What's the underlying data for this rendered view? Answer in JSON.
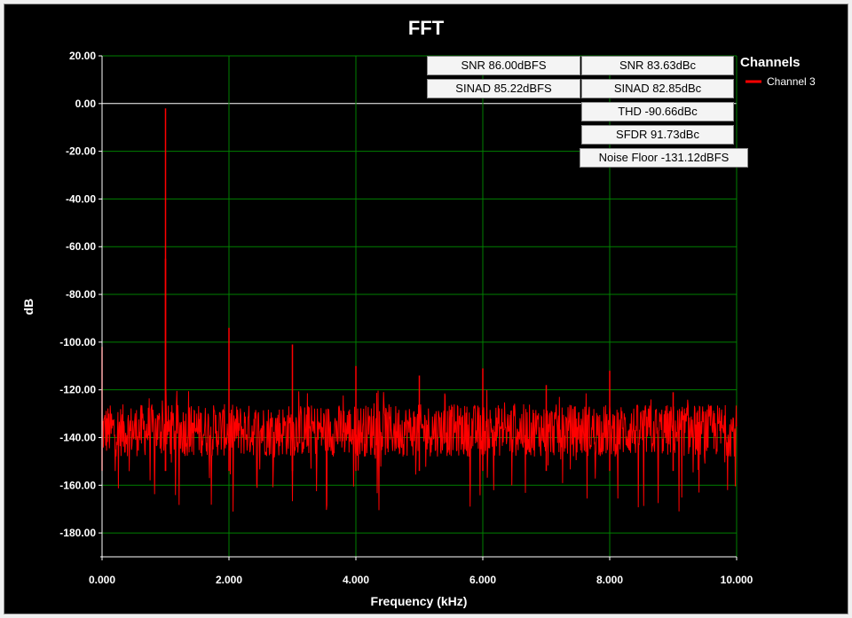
{
  "chart_data": {
    "type": "line",
    "title": "FFT",
    "xlabel": "Frequency (kHz)",
    "ylabel": "dB",
    "xlim": [
      0,
      10
    ],
    "ylim": [
      -190,
      20
    ],
    "x_ticks": [
      "0.000",
      "2.000",
      "4.000",
      "6.000",
      "8.000",
      "10.000"
    ],
    "y_ticks": [
      "20.00",
      "0.00",
      "-20.00",
      "-40.00",
      "-60.00",
      "-80.00",
      "-100.00",
      "-120.00",
      "-140.00",
      "-160.00",
      "-180.00"
    ],
    "grid": true,
    "legend": {
      "title": "Channels",
      "position": "top-right",
      "entries": [
        {
          "name": "Channel 3",
          "color": "#ff0000"
        }
      ]
    },
    "series": [
      {
        "name": "Channel 3",
        "color": "#ff0000",
        "noise_floor_band_db": [
          -148,
          -126
        ],
        "peaks": [
          {
            "x": 0.0,
            "y": -102
          },
          {
            "x": 1.0,
            "y": -2
          },
          {
            "x": 1.0,
            "y": -65
          },
          {
            "x": 2.0,
            "y": -94
          },
          {
            "x": 3.0,
            "y": -101
          },
          {
            "x": 4.0,
            "y": -110
          },
          {
            "x": 5.0,
            "y": -114
          },
          {
            "x": 6.0,
            "y": -111
          },
          {
            "x": 7.0,
            "y": -118
          },
          {
            "x": 8.0,
            "y": -112
          },
          {
            "x": 9.0,
            "y": -121
          }
        ]
      }
    ],
    "metrics": [
      {
        "label": "SNR 86.00dBFS"
      },
      {
        "label": "SNR 83.63dBc"
      },
      {
        "label": "SINAD 85.22dBFS"
      },
      {
        "label": "SINAD 82.85dBc"
      },
      {
        "label": "THD -90.66dBc"
      },
      {
        "label": "SFDR 91.73dBc"
      },
      {
        "label": "Noise Floor -131.12dBFS"
      }
    ],
    "colors": {
      "background": "#000000",
      "grid": "#008000",
      "zero_line": "#ffffff",
      "text": "#ffffff",
      "trace": "#ff0000"
    }
  }
}
